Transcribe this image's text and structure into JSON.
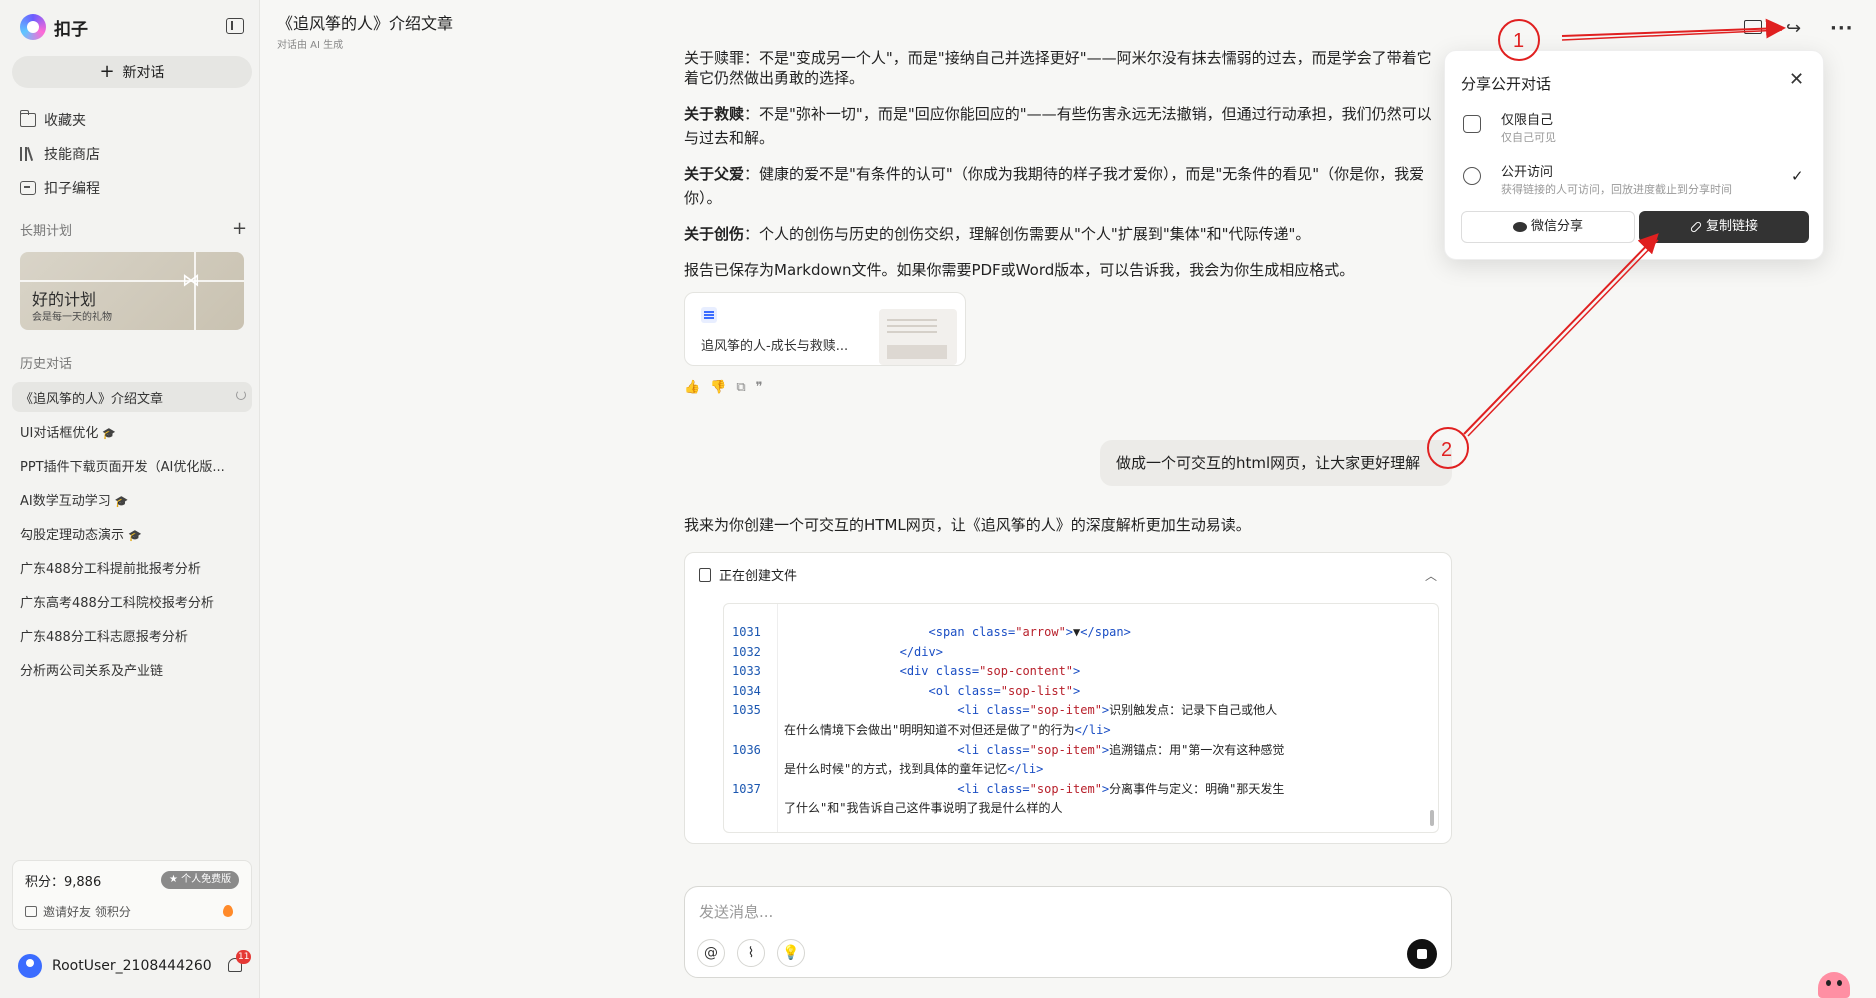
{
  "app": {
    "name": "扣子"
  },
  "sidebar": {
    "new_chat": "新对话",
    "nav": [
      {
        "label": "收藏夹",
        "icon": "folder-icon"
      },
      {
        "label": "技能商店",
        "icon": "books-icon"
      },
      {
        "label": "扣子编程",
        "icon": "code-icon"
      }
    ],
    "long_plan_label": "长期计划",
    "plan_card": {
      "title": "好的计划",
      "subtitle": "会是每一天的礼物"
    },
    "history_label": "历史对话",
    "history": [
      {
        "label": "《追风筝的人》介绍文章"
      },
      {
        "label": "UI对话框优化",
        "suffix": "🎓"
      },
      {
        "label": "PPT插件下载页面开发（AI优化版..."
      },
      {
        "label": "AI数学互动学习",
        "suffix": "🎓"
      },
      {
        "label": "勾股定理动态演示",
        "suffix": "🎓"
      },
      {
        "label": "广东488分工科提前批报考分析"
      },
      {
        "label": "广东高考488分工科院校报考分析"
      },
      {
        "label": "广东488分工科志愿报考分析"
      },
      {
        "label": "分析两公司关系及产业链"
      }
    ],
    "points_label": "积分：9,886",
    "plan_badge": "★ 个人免费版",
    "invite_label": "邀请好友 领积分",
    "user_name": "RootUser_2108444260",
    "notif_count": "11"
  },
  "header": {
    "title": "《追风筝的人》介绍文章",
    "subtitle": "对话由 AI 生成"
  },
  "messages": {
    "p_top": "关于赎罪：不是\"变成另一个人\"，而是\"接纳自己并选择更好\"——阿米尔没有抹去懦弱的过去，而是学会了带着它仍然做出勇敢的选择。",
    "p_top_tail": "着它仍然做出勇敢的选择。",
    "p1_bold": "关于救赎",
    "p1_text": "：不是\"弥补一切\"，而是\"回应你能回应的\"——有些伤害永远无法撤销，但通过行动承担，我们仍然可以与过去和解。",
    "p2_bold": "关于父爱",
    "p2_text": "：健康的爱不是\"有条件的认可\"（你成为我期待的样子我才爱你），而是\"无条件的看见\"（你是你，我爱你）。",
    "p3_bold": "关于创伤",
    "p3_text": "：个人的创伤与历史的创伤交织，理解创伤需要从\"个人\"扩展到\"集体\"和\"代际传递\"。",
    "p4_text": "报告已保存为Markdown文件。如果你需要PDF或Word版本，可以告诉我，我会为你生成相应格式。",
    "file_name": "追风筝的人-成长与救赎...",
    "user_message": "做成一个可交互的html网页，让大家更好理解",
    "reply": "我来为你创建一个可交互的HTML网页，让《追风筝的人》的深度解析更加生动易读。",
    "creating_label": "正在创建文件"
  },
  "code": {
    "lines": [
      {
        "n": "1031",
        "indent": "                    ",
        "html": "<span class=\"tag\">&lt;span</span> <span class=\"att\">class=</span><span class=\"val\">\"arrow\"</span><span class=\"tag\">&gt;</span>▼<span class=\"tag\">&lt;/span&gt;</span>"
      },
      {
        "n": "1032",
        "indent": "                ",
        "html": "<span class=\"tag\">&lt;/div&gt;</span>"
      },
      {
        "n": "1033",
        "indent": "                ",
        "html": "<span class=\"tag\">&lt;div</span> <span class=\"att\">class=</span><span class=\"val\">\"sop-content\"</span><span class=\"tag\">&gt;</span>"
      },
      {
        "n": "1034",
        "indent": "                    ",
        "html": "<span class=\"tag\">&lt;ol</span> <span class=\"att\">class=</span><span class=\"val\">\"sop-list\"</span><span class=\"tag\">&gt;</span>"
      },
      {
        "n": "1035",
        "indent": "                        ",
        "html": "<span class=\"tag\">&lt;li</span> <span class=\"att\">class=</span><span class=\"val\">\"sop-item\"</span><span class=\"tag\">&gt;</span>识别触发点：记录下自己或他人"
      },
      {
        "n": "",
        "indent": "",
        "html": "在什么情境下会做出\"明明知道不对但还是做了\"的行为<span class=\"tag\">&lt;/li&gt;</span>"
      },
      {
        "n": "1036",
        "indent": "                        ",
        "html": "<span class=\"tag\">&lt;li</span> <span class=\"att\">class=</span><span class=\"val\">\"sop-item\"</span><span class=\"tag\">&gt;</span>追溯锚点：用\"第一次有这种感觉"
      },
      {
        "n": "",
        "indent": "",
        "html": "是什么时候\"的方式，找到具体的童年记忆<span class=\"tag\">&lt;/li&gt;</span>"
      },
      {
        "n": "1037",
        "indent": "                        ",
        "html": "<span class=\"tag\">&lt;li</span> <span class=\"att\">class=</span><span class=\"val\">\"sop-item\"</span><span class=\"tag\">&gt;</span>分离事件与定义：明确\"那天发生"
      },
      {
        "n": "",
        "indent": "",
        "html": "了什么\"和\"我告诉自己这件事说明了我是什么样的人"
      }
    ]
  },
  "input": {
    "placeholder": "发送消息..."
  },
  "share": {
    "title": "分享公开对话",
    "opt1_title": "仅限自己",
    "opt1_desc": "仅自己可见",
    "opt2_title": "公开访问",
    "opt2_desc": "获得链接的人可访问，回放进度截止到分享时间",
    "wechat_label": "微信分享",
    "copy_label": "复制链接"
  },
  "annotations": {
    "n1": "1",
    "n2": "2",
    "color": "#e02020"
  }
}
